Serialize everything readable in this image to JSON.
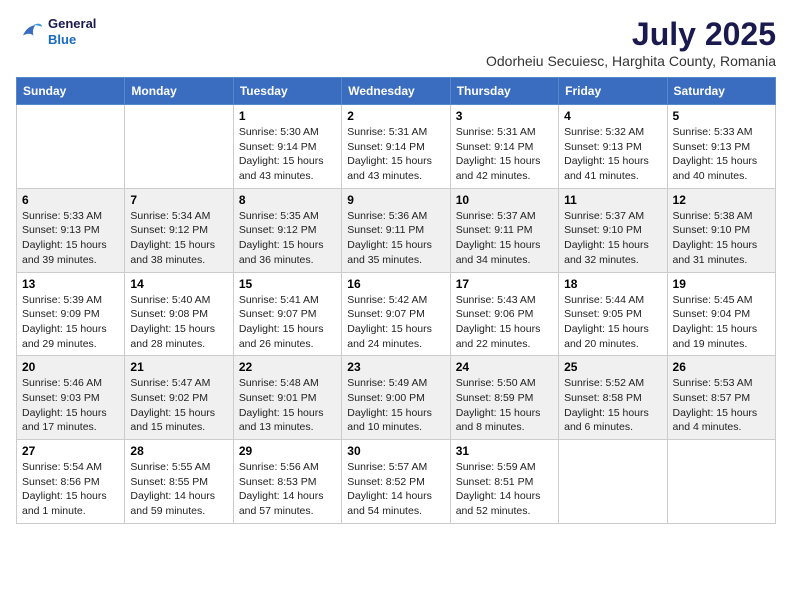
{
  "header": {
    "logo_general": "General",
    "logo_blue": "Blue",
    "title": "July 2025",
    "subtitle": "Odorheiu Secuiesc, Harghita County, Romania"
  },
  "weekdays": [
    "Sunday",
    "Monday",
    "Tuesday",
    "Wednesday",
    "Thursday",
    "Friday",
    "Saturday"
  ],
  "weeks": [
    [
      {
        "day": "",
        "sunrise": "",
        "sunset": "",
        "daylight": ""
      },
      {
        "day": "",
        "sunrise": "",
        "sunset": "",
        "daylight": ""
      },
      {
        "day": "1",
        "sunrise": "Sunrise: 5:30 AM",
        "sunset": "Sunset: 9:14 PM",
        "daylight": "Daylight: 15 hours and 43 minutes."
      },
      {
        "day": "2",
        "sunrise": "Sunrise: 5:31 AM",
        "sunset": "Sunset: 9:14 PM",
        "daylight": "Daylight: 15 hours and 43 minutes."
      },
      {
        "day": "3",
        "sunrise": "Sunrise: 5:31 AM",
        "sunset": "Sunset: 9:14 PM",
        "daylight": "Daylight: 15 hours and 42 minutes."
      },
      {
        "day": "4",
        "sunrise": "Sunrise: 5:32 AM",
        "sunset": "Sunset: 9:13 PM",
        "daylight": "Daylight: 15 hours and 41 minutes."
      },
      {
        "day": "5",
        "sunrise": "Sunrise: 5:33 AM",
        "sunset": "Sunset: 9:13 PM",
        "daylight": "Daylight: 15 hours and 40 minutes."
      }
    ],
    [
      {
        "day": "6",
        "sunrise": "Sunrise: 5:33 AM",
        "sunset": "Sunset: 9:13 PM",
        "daylight": "Daylight: 15 hours and 39 minutes."
      },
      {
        "day": "7",
        "sunrise": "Sunrise: 5:34 AM",
        "sunset": "Sunset: 9:12 PM",
        "daylight": "Daylight: 15 hours and 38 minutes."
      },
      {
        "day": "8",
        "sunrise": "Sunrise: 5:35 AM",
        "sunset": "Sunset: 9:12 PM",
        "daylight": "Daylight: 15 hours and 36 minutes."
      },
      {
        "day": "9",
        "sunrise": "Sunrise: 5:36 AM",
        "sunset": "Sunset: 9:11 PM",
        "daylight": "Daylight: 15 hours and 35 minutes."
      },
      {
        "day": "10",
        "sunrise": "Sunrise: 5:37 AM",
        "sunset": "Sunset: 9:11 PM",
        "daylight": "Daylight: 15 hours and 34 minutes."
      },
      {
        "day": "11",
        "sunrise": "Sunrise: 5:37 AM",
        "sunset": "Sunset: 9:10 PM",
        "daylight": "Daylight: 15 hours and 32 minutes."
      },
      {
        "day": "12",
        "sunrise": "Sunrise: 5:38 AM",
        "sunset": "Sunset: 9:10 PM",
        "daylight": "Daylight: 15 hours and 31 minutes."
      }
    ],
    [
      {
        "day": "13",
        "sunrise": "Sunrise: 5:39 AM",
        "sunset": "Sunset: 9:09 PM",
        "daylight": "Daylight: 15 hours and 29 minutes."
      },
      {
        "day": "14",
        "sunrise": "Sunrise: 5:40 AM",
        "sunset": "Sunset: 9:08 PM",
        "daylight": "Daylight: 15 hours and 28 minutes."
      },
      {
        "day": "15",
        "sunrise": "Sunrise: 5:41 AM",
        "sunset": "Sunset: 9:07 PM",
        "daylight": "Daylight: 15 hours and 26 minutes."
      },
      {
        "day": "16",
        "sunrise": "Sunrise: 5:42 AM",
        "sunset": "Sunset: 9:07 PM",
        "daylight": "Daylight: 15 hours and 24 minutes."
      },
      {
        "day": "17",
        "sunrise": "Sunrise: 5:43 AM",
        "sunset": "Sunset: 9:06 PM",
        "daylight": "Daylight: 15 hours and 22 minutes."
      },
      {
        "day": "18",
        "sunrise": "Sunrise: 5:44 AM",
        "sunset": "Sunset: 9:05 PM",
        "daylight": "Daylight: 15 hours and 20 minutes."
      },
      {
        "day": "19",
        "sunrise": "Sunrise: 5:45 AM",
        "sunset": "Sunset: 9:04 PM",
        "daylight": "Daylight: 15 hours and 19 minutes."
      }
    ],
    [
      {
        "day": "20",
        "sunrise": "Sunrise: 5:46 AM",
        "sunset": "Sunset: 9:03 PM",
        "daylight": "Daylight: 15 hours and 17 minutes."
      },
      {
        "day": "21",
        "sunrise": "Sunrise: 5:47 AM",
        "sunset": "Sunset: 9:02 PM",
        "daylight": "Daylight: 15 hours and 15 minutes."
      },
      {
        "day": "22",
        "sunrise": "Sunrise: 5:48 AM",
        "sunset": "Sunset: 9:01 PM",
        "daylight": "Daylight: 15 hours and 13 minutes."
      },
      {
        "day": "23",
        "sunrise": "Sunrise: 5:49 AM",
        "sunset": "Sunset: 9:00 PM",
        "daylight": "Daylight: 15 hours and 10 minutes."
      },
      {
        "day": "24",
        "sunrise": "Sunrise: 5:50 AM",
        "sunset": "Sunset: 8:59 PM",
        "daylight": "Daylight: 15 hours and 8 minutes."
      },
      {
        "day": "25",
        "sunrise": "Sunrise: 5:52 AM",
        "sunset": "Sunset: 8:58 PM",
        "daylight": "Daylight: 15 hours and 6 minutes."
      },
      {
        "day": "26",
        "sunrise": "Sunrise: 5:53 AM",
        "sunset": "Sunset: 8:57 PM",
        "daylight": "Daylight: 15 hours and 4 minutes."
      }
    ],
    [
      {
        "day": "27",
        "sunrise": "Sunrise: 5:54 AM",
        "sunset": "Sunset: 8:56 PM",
        "daylight": "Daylight: 15 hours and 1 minute."
      },
      {
        "day": "28",
        "sunrise": "Sunrise: 5:55 AM",
        "sunset": "Sunset: 8:55 PM",
        "daylight": "Daylight: 14 hours and 59 minutes."
      },
      {
        "day": "29",
        "sunrise": "Sunrise: 5:56 AM",
        "sunset": "Sunset: 8:53 PM",
        "daylight": "Daylight: 14 hours and 57 minutes."
      },
      {
        "day": "30",
        "sunrise": "Sunrise: 5:57 AM",
        "sunset": "Sunset: 8:52 PM",
        "daylight": "Daylight: 14 hours and 54 minutes."
      },
      {
        "day": "31",
        "sunrise": "Sunrise: 5:59 AM",
        "sunset": "Sunset: 8:51 PM",
        "daylight": "Daylight: 14 hours and 52 minutes."
      },
      {
        "day": "",
        "sunrise": "",
        "sunset": "",
        "daylight": ""
      },
      {
        "day": "",
        "sunrise": "",
        "sunset": "",
        "daylight": ""
      }
    ]
  ]
}
